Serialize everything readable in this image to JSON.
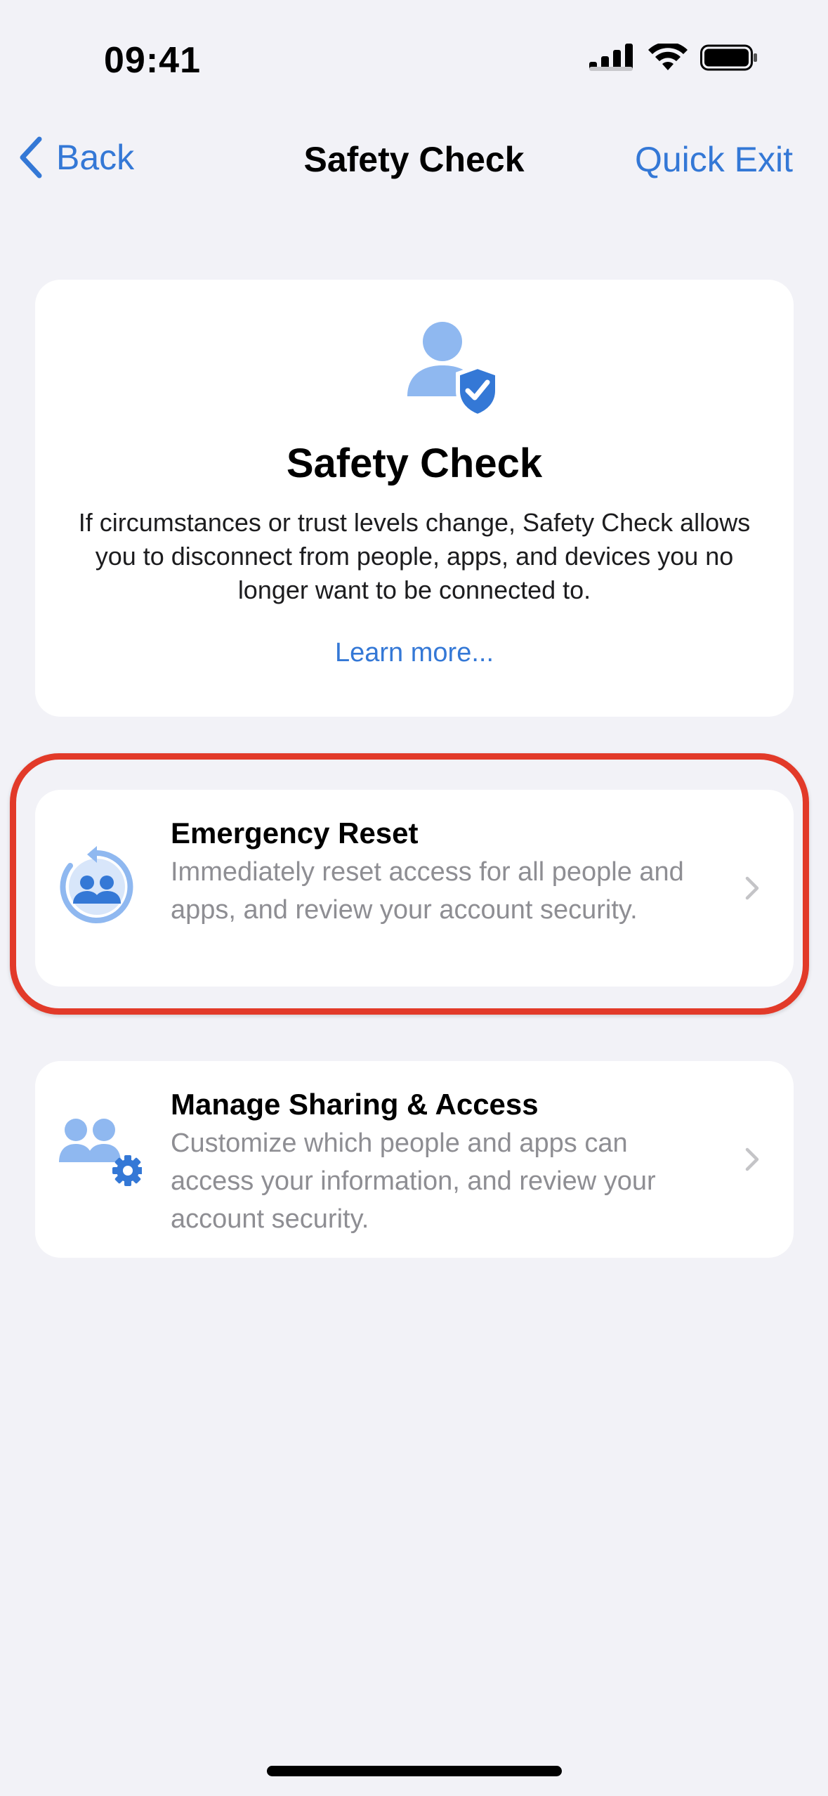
{
  "status_bar": {
    "time": "09:41",
    "signal_icon": "cellular-signal-icon",
    "wifi_icon": "wifi-icon",
    "battery_icon": "battery-icon"
  },
  "nav": {
    "back_label": "Back",
    "title": "Safety Check",
    "quick_exit_label": "Quick Exit"
  },
  "hero": {
    "icon": "person-shield-check-icon",
    "title": "Safety Check",
    "description": "If circumstances or trust levels change, Safety Check allows you to disconnect from people, apps, and devices you no longer want to be connected to.",
    "learn_more": "Learn more..."
  },
  "options": [
    {
      "icon": "emergency-reset-icon",
      "title": "Emergency Reset",
      "description": "Immediately reset access for all people and apps, and review your account security."
    },
    {
      "icon": "people-gear-icon",
      "title": "Manage Sharing & Access",
      "description": "Customize which people and apps can access your information, and review your account security."
    }
  ],
  "colors": {
    "accent": "#3478d6",
    "icon_light_blue": "#8fb8f0",
    "icon_blue": "#3478d6",
    "highlight": "#e23a29",
    "background": "#f2f2f7"
  }
}
